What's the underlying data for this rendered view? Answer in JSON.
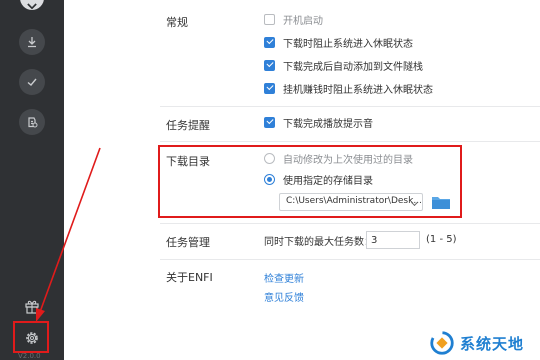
{
  "sidebar": {
    "items": [
      {
        "icon": "download-icon"
      },
      {
        "icon": "check-icon"
      },
      {
        "icon": "trash-icon"
      }
    ],
    "gift_icon": "gift-icon",
    "settings_icon": "gear-icon",
    "version": "V2.0.0"
  },
  "settings": {
    "general": {
      "label": "常规",
      "options": [
        {
          "text": "开机启动",
          "checked": false
        },
        {
          "text": "下载时阻止系统进入休眠状态",
          "checked": true
        },
        {
          "text": "下载完成后自动添加到文件隧栈",
          "checked": true
        },
        {
          "text": "挂机赚钱时阻止系统进入休眠状态",
          "checked": true
        }
      ]
    },
    "reminder": {
      "label": "任务提醒",
      "options": [
        {
          "text": "下载完成播放提示音",
          "checked": true
        }
      ]
    },
    "download_dir": {
      "label": "下载目录",
      "radios": [
        {
          "text": "自动修改为上次使用过的目录",
          "selected": false
        },
        {
          "text": "使用指定的存储目录",
          "selected": true
        }
      ],
      "path": "C:\\Users\\Administrator\\Desk...",
      "folder_icon": "folder-icon"
    },
    "task_mgmt": {
      "label": "任务管理",
      "max_label": "同时下载的最大任务数：",
      "max_value": "3",
      "range": "(1 - 5)"
    },
    "about": {
      "label": "关于ENFI",
      "check_update": "检查更新",
      "feedback": "意见反馈"
    }
  },
  "watermark": {
    "text": "系统天地"
  },
  "colors": {
    "accent": "#2f80d8",
    "annotation": "#e01b1b",
    "sidebar_bg": "#2f3134"
  }
}
